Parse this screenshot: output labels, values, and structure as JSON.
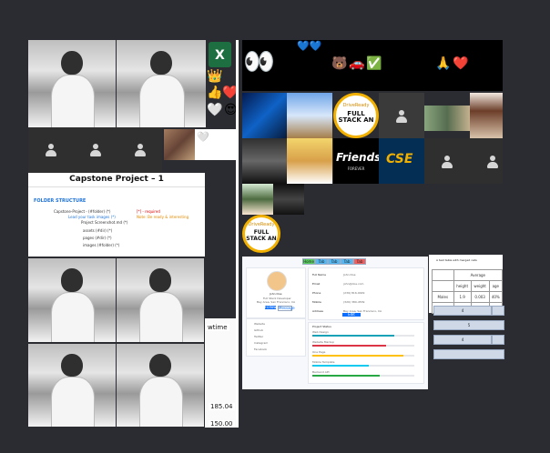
{
  "colors": {
    "background": "#2b2c31",
    "dark_tile": "#2f2f2f",
    "profile_bg": "#f7f8fb",
    "accent_blue": "#1e73d8"
  },
  "left_panel": {
    "document": {
      "title": "Capstone Project – 1",
      "folder_heading": "FOLDER STRUCTURE",
      "lines": [
        "Capstone-Project - (#folder) (*)",
        "Lead your task  images (*)",
        "Project Screenshot.md (*)",
        "   assets (#dir) (*)",
        "   pages (#dir) (*)",
        "   images (#folder) (*)"
      ],
      "notes": [
        "[*] - required",
        "Note: Be ready & interesting"
      ]
    },
    "overlay_text": {
      "time_label": "wtime",
      "value_1": "185.04",
      "value_2": "150.00"
    },
    "icons": {
      "excel": "excel-icon",
      "crown": "crown-icon",
      "thumbs": "thumbs-up-icon",
      "heart": "heart-icon"
    }
  },
  "right_panel": {
    "emoji_row": [
      "👀",
      "💙💙",
      "😍",
      "🐻",
      "🚗",
      "✅",
      "😍",
      "😃",
      "😂",
      "🙏",
      "❤️",
      "😇",
      "😂"
    ],
    "brands": [
      {
        "sub": "DriveReady",
        "main": "FULL STACK AN"
      },
      {
        "sub": "DriveReady",
        "main": "FULL STACK AN"
      }
    ],
    "friends": {
      "title": "Friends",
      "subtitle": "FOREVER"
    },
    "cse": {
      "text": "CSE"
    },
    "profile": {
      "name": "John Doe",
      "role": "Full Stack Developer",
      "location": "Bay Area, San Francisco, CA",
      "follow_button": "Follow",
      "message_button": "Message",
      "links": [
        "Website",
        "Github",
        "Twitter",
        "Instagram",
        "Facebook"
      ],
      "fields": [
        {
          "label": "Full Name",
          "value": "John Doe"
        },
        {
          "label": "Email",
          "value": "john@doe.com"
        },
        {
          "label": "Phone",
          "value": "(239) 816-9029"
        },
        {
          "label": "Mobile",
          "value": "(320) 380-4539"
        },
        {
          "label": "Address",
          "value": "Bay Area, San Francisco, CA"
        }
      ],
      "edit_button": "Edit",
      "project_status_title": "Project Status",
      "progress": [
        {
          "label": "Web Design",
          "value": 80
        },
        {
          "label": "Website Markup",
          "value": 72
        },
        {
          "label": "One Page",
          "value": 89
        },
        {
          "label": "Mobile Template",
          "value": 55
        },
        {
          "label": "Backend API",
          "value": 66
        }
      ],
      "tabs": [
        "Home",
        "Tab",
        "Tab",
        "Tab",
        "Tab"
      ]
    },
    "table": {
      "caption": "A test table with merged cells",
      "group_header": "Average",
      "columns": [
        "height",
        "weight",
        "age"
      ],
      "rows": [
        {
          "label": "Males",
          "values": [
            "1.9",
            "0.003",
            "40%"
          ]
        },
        {
          "label": "Females",
          "values": [
            "1.7",
            "0.002",
            "43%"
          ]
        }
      ]
    },
    "side_buttons": [
      "4",
      "5",
      "4"
    ]
  }
}
